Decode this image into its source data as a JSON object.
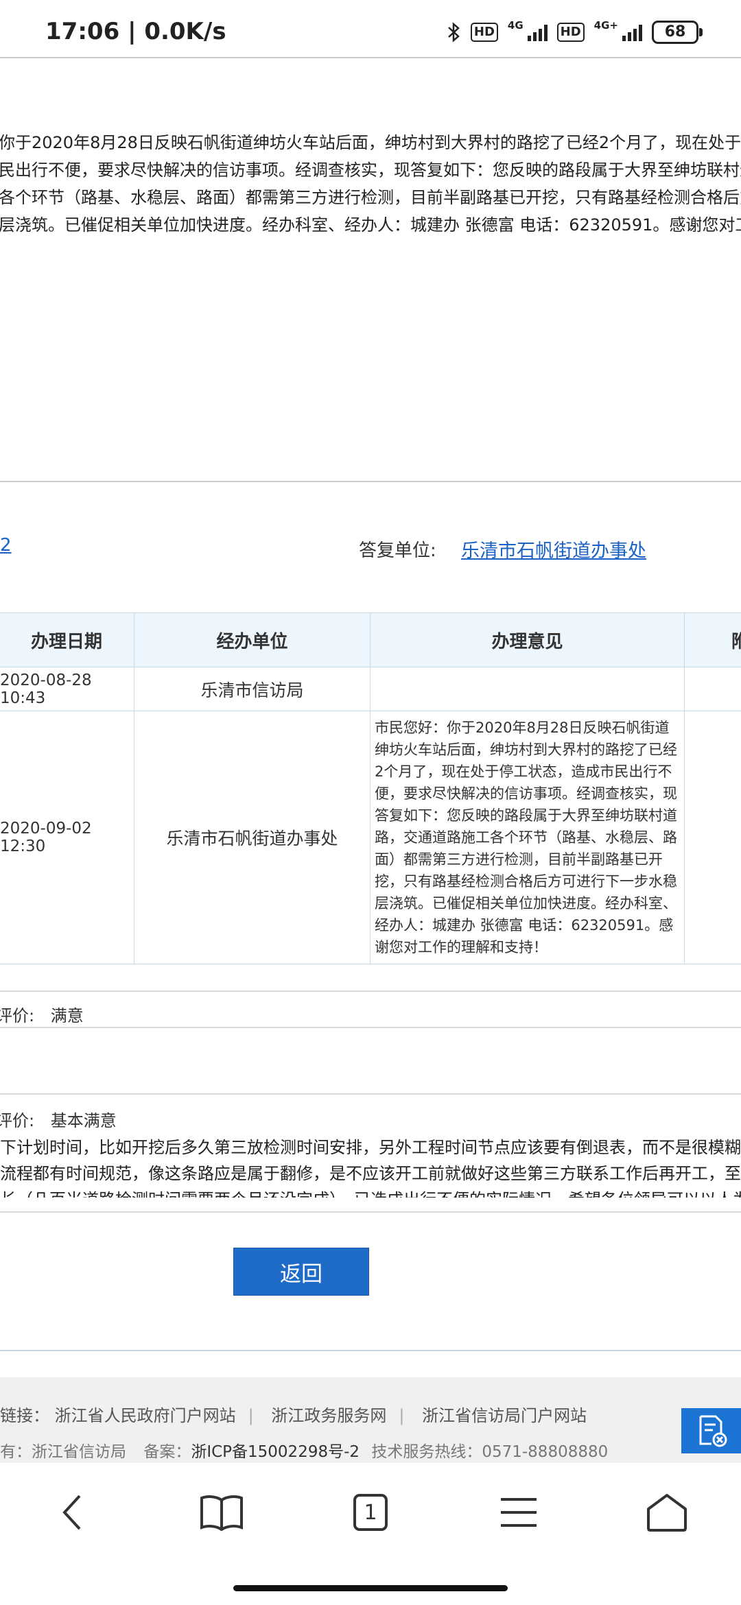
{
  "status": {
    "time_speed": "17:06 | 0.0K/s",
    "hd1": "HD",
    "net1": "4G",
    "hd2": "HD",
    "net2": "4G+",
    "battery": "68"
  },
  "reply_text": [
    "你于2020年8月28日反映石帆街道绅坊火车站后面，绅坊村到大界村的路挖了已经2个月了，现在处于停",
    "民出行不便，要求尽快解决的信访事项。经调查核实，现答复如下：您反映的路段属于大界至绅坊联村道",
    "各个环节（路基、水稳层、路面）都需第三方进行检测，目前半副路基已开挖，只有路基经检测合格后方",
    "层浇筑。已催促相关单位加快进度。经办科室、经办人：城建办  张德富  电话：62320591。感谢您对工"
  ],
  "reply_info": {
    "left_fragment": "2",
    "unit_label": "答复单位:",
    "unit_value": "乐清市石帆街道办事处"
  },
  "table": {
    "headers": [
      "办理日期",
      "经办单位",
      "办理意见",
      "附"
    ],
    "rows": [
      {
        "date": "2020-08-28 10:43",
        "unit": "乐清市信访局",
        "opinion": ""
      },
      {
        "date": "2020-09-02 12:30",
        "unit": "乐清市石帆街道办事处",
        "opinion": "市民您好：你于2020年8月28日反映石帆街道绅坊火车站后面，绅坊村到大界村的路挖了已经2个月了，现在处于停工状态，造成市民出行不便，要求尽快解决的信访事项。经调查核实，现答复如下：您反映的路段属于大界至绅坊联村道路，交通道路施工各个环节（路基、水稳层、路面）都需第三方进行检测，目前半副路基已开挖，只有路基经检测合格后方可进行下一步水稳层浇筑。已催促相关单位加快进度。经办科室、经办人：城建办 张德富 电话：62320591。感谢您对工作的理解和支持！"
      }
    ]
  },
  "evaluations": {
    "first_label": "评价:",
    "first_value": "满意",
    "second_label": "评价:",
    "second_value": "基本满意"
  },
  "comment_lines": [
    "下计划时间，比如开挖后多久第三放检测时间安排，另外工程时间节点应该要有倒退表，而不是很模糊的",
    "流程都有时间规范，像这条路应是属于翻修，是不应该开工前就做好这些第三方联系工作后再开工，至少",
    "长（几百米道路检测时间需要两个月还没完成），已造成出行不便的实际情况，希望各位领导可以以人为"
  ],
  "back_button": "返回",
  "footer": {
    "links_prefix": "链接：",
    "links": [
      "浙江省人民政府门户网站",
      "浙江政务服务网",
      "浙江省信访局门户网站"
    ],
    "owner": "有：浙江省信访局",
    "icp_label": "备案：",
    "icp_value": "浙ICP备15002298号-2",
    "hotline": "技术服务热线：0571-88808880"
  },
  "nav": {
    "tab_count": "1"
  }
}
